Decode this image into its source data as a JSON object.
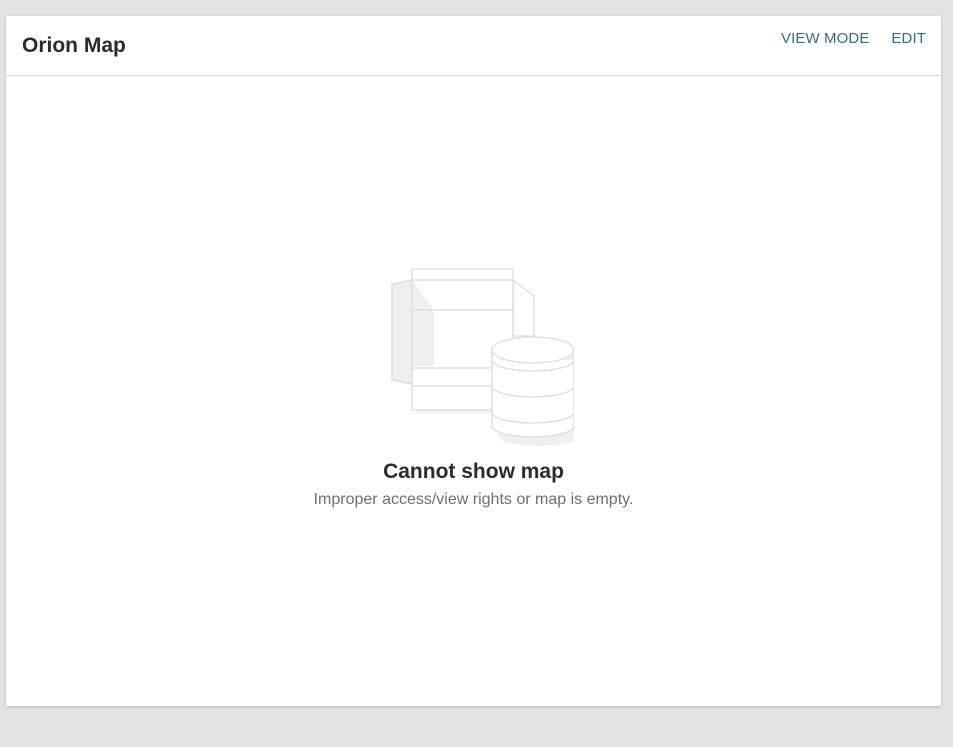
{
  "panel": {
    "title": "Orion Map",
    "actions": {
      "view_mode_label": "VIEW MODE",
      "edit_label": "EDIT"
    }
  },
  "empty_state": {
    "icon": "empty-box-database-icon",
    "title": "Cannot show map",
    "message": "Improper access/view rights or map is empty."
  },
  "colors": {
    "background": "#e2e3e4",
    "panel": "#ffffff",
    "link": "#2d6e8a",
    "title_text": "#2b2b2b",
    "muted_text": "#6f6f6f",
    "illustration_stroke": "#dddddd",
    "illustration_fill": "#f2f2f2"
  }
}
